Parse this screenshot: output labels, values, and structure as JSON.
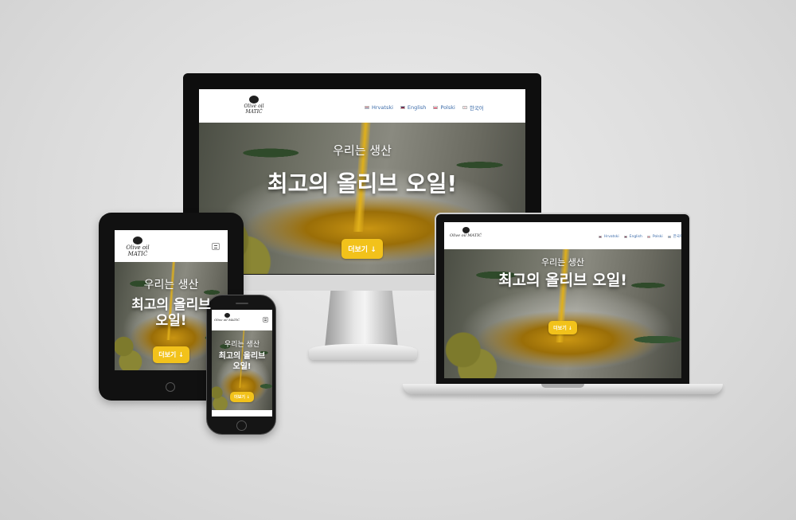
{
  "site": {
    "logo_text": "Olive oil MATIĆ",
    "logo_text_short": "Olive oil MATIĆ",
    "hero_subtitle": "우리는 생산",
    "hero_title": "최고의 올리브 오일!",
    "hero_title_line1": "최고의 올리브",
    "hero_title_line2": "오일!",
    "hero_title_phone_line1": "최고의 올리브",
    "hero_title_phone_line2": "오일!",
    "cta_label": "더보기 ↓"
  },
  "languages": [
    {
      "label": "Hrvatski",
      "flag": "flag-hr-icon"
    },
    {
      "label": "English",
      "flag": "flag-en-icon"
    },
    {
      "label": "Polski",
      "flag": "flag-pl-icon"
    },
    {
      "label": "한국어",
      "flag": "flag-kr-icon"
    }
  ],
  "colors": {
    "accent": "#f2c21b",
    "link": "#3a6aa8",
    "background": "#dcdcdc"
  }
}
